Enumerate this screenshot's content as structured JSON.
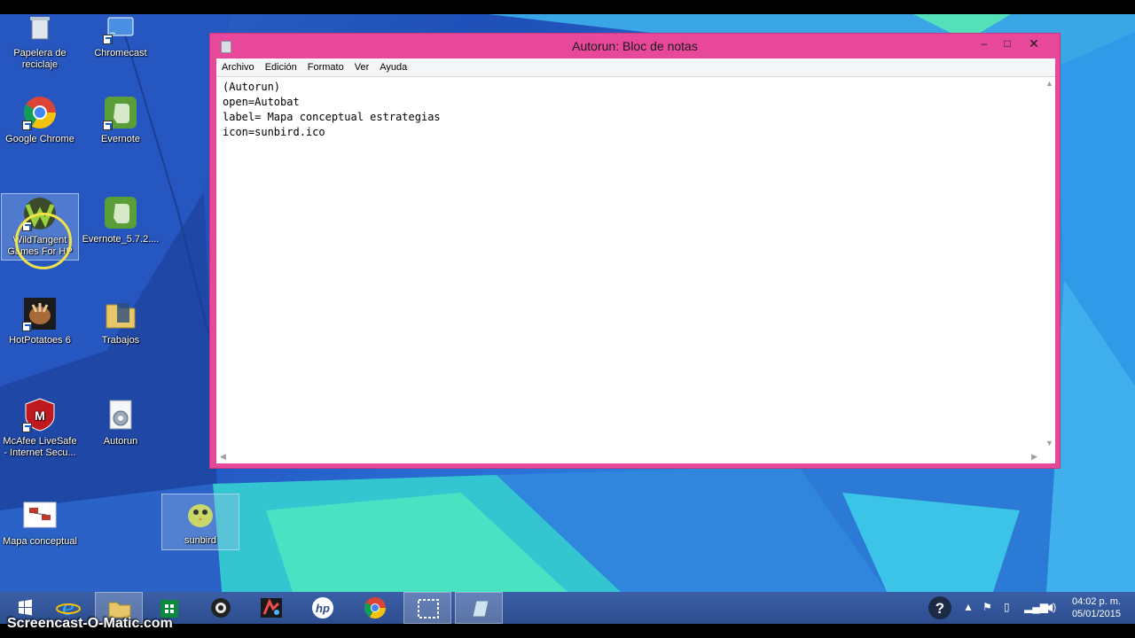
{
  "desktop": {
    "icons": [
      {
        "label": "Papelera de reciclaje",
        "icon": "recycle-bin-icon"
      },
      {
        "label": "Chromecast",
        "icon": "chromecast-icon"
      },
      {
        "label": "Google Chrome",
        "icon": "chrome-icon"
      },
      {
        "label": "Evernote",
        "icon": "evernote-icon"
      },
      {
        "label": "WildTangent Games For HP",
        "icon": "wildtangent-icon"
      },
      {
        "label": "Evernote_5.7.2....",
        "icon": "evernote-installer-icon"
      },
      {
        "label": "HotPotatoes 6",
        "icon": "hotpotatoes-icon"
      },
      {
        "label": "Trabajos",
        "icon": "folder-icon"
      },
      {
        "label": "McAfee LiveSafe - Internet Secu...",
        "icon": "mcafee-icon"
      },
      {
        "label": "Autorun",
        "icon": "autorun-settings-icon"
      },
      {
        "label": "Mapa conceptual",
        "icon": "document-icon"
      },
      {
        "label": "sunbird",
        "icon": "sunbird-icon"
      }
    ]
  },
  "notepad": {
    "title": "Autorun: Bloc de notas",
    "menu": [
      "Archivo",
      "Edición",
      "Formato",
      "Ver",
      "Ayuda"
    ],
    "lines": [
      "(Autorun)",
      "open=Autobat",
      "label= Mapa conceptual estrategias",
      "icon=sunbird.ico"
    ],
    "buttons": {
      "minimize": "–",
      "maximize": "□",
      "close": "✕"
    }
  },
  "taskbar": {
    "apps": [
      "start-icon",
      "internet-explorer-icon",
      "file-explorer-icon",
      "store-icon",
      "camera-app-icon",
      "games-icon",
      "hp-icon",
      "chrome-icon",
      "snipping-tool-icon",
      "notepad-icon"
    ],
    "time": "04:02 p. m.",
    "date": "05/01/2015"
  },
  "watermark": "Screencast-O-Matic.com",
  "colors": {
    "notepad_frame": "#e8489a",
    "taskbar": "#2d4d8e"
  }
}
